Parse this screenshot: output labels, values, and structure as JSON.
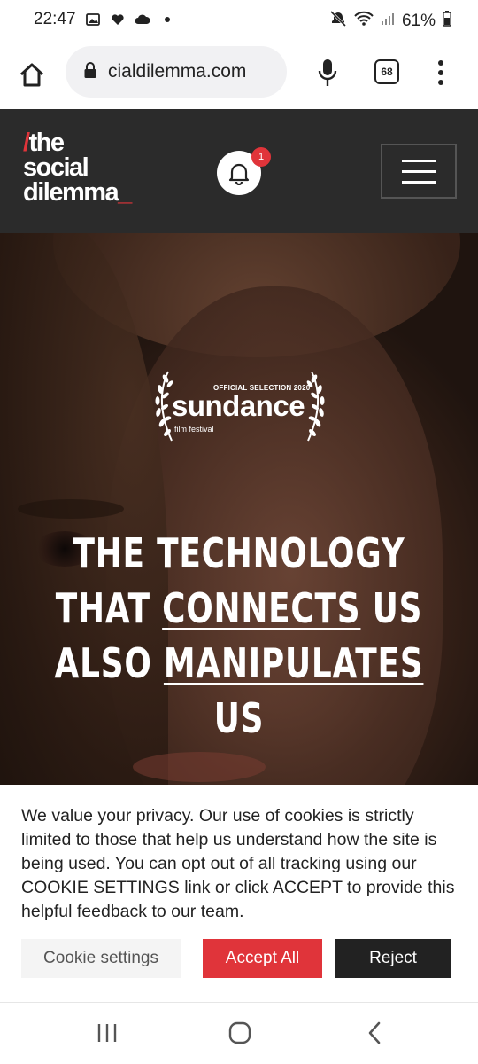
{
  "status_bar": {
    "time": "22:47",
    "battery": "61%",
    "left_icons": [
      "gallery-icon",
      "heart-icon",
      "cloud-icon",
      "dot-icon"
    ],
    "right_icons": [
      "mute-icon",
      "wifi-icon",
      "signal-icon",
      "battery-icon"
    ]
  },
  "browser": {
    "url": "cialdilemma.com",
    "tab_count": "68"
  },
  "site_header": {
    "logo_line1": "the",
    "logo_line2": "social",
    "logo_line3": "dilemma",
    "logo_slash": "/",
    "logo_underscore": "_",
    "notification_count": "1",
    "brand_color": "#e0343a"
  },
  "hero": {
    "laurel_top": "OFFICIAL SELECTION 2020",
    "laurel_title": "sundance",
    "laurel_sub": "film festival",
    "headline_1": "THE TECHNOLOGY",
    "headline_2a": "THAT ",
    "headline_2b": "CONNECTS",
    "headline_2c": " US",
    "headline_3a": "ALSO ",
    "headline_3b": "MANIPULATES",
    "headline_4": "US"
  },
  "cookie_banner": {
    "text": "We value your privacy. Our use of cookies is strictly limited to those that help us understand how the site is being used. You can opt out of all tracking using our COOKIE SETTINGS link or click ACCEPT to provide this helpful feedback to our team.",
    "settings_label": "Cookie settings",
    "accept_label": "Accept All",
    "reject_label": "Reject"
  },
  "nav_bar": {
    "icons": [
      "recent-apps-icon",
      "home-icon",
      "back-icon"
    ]
  }
}
